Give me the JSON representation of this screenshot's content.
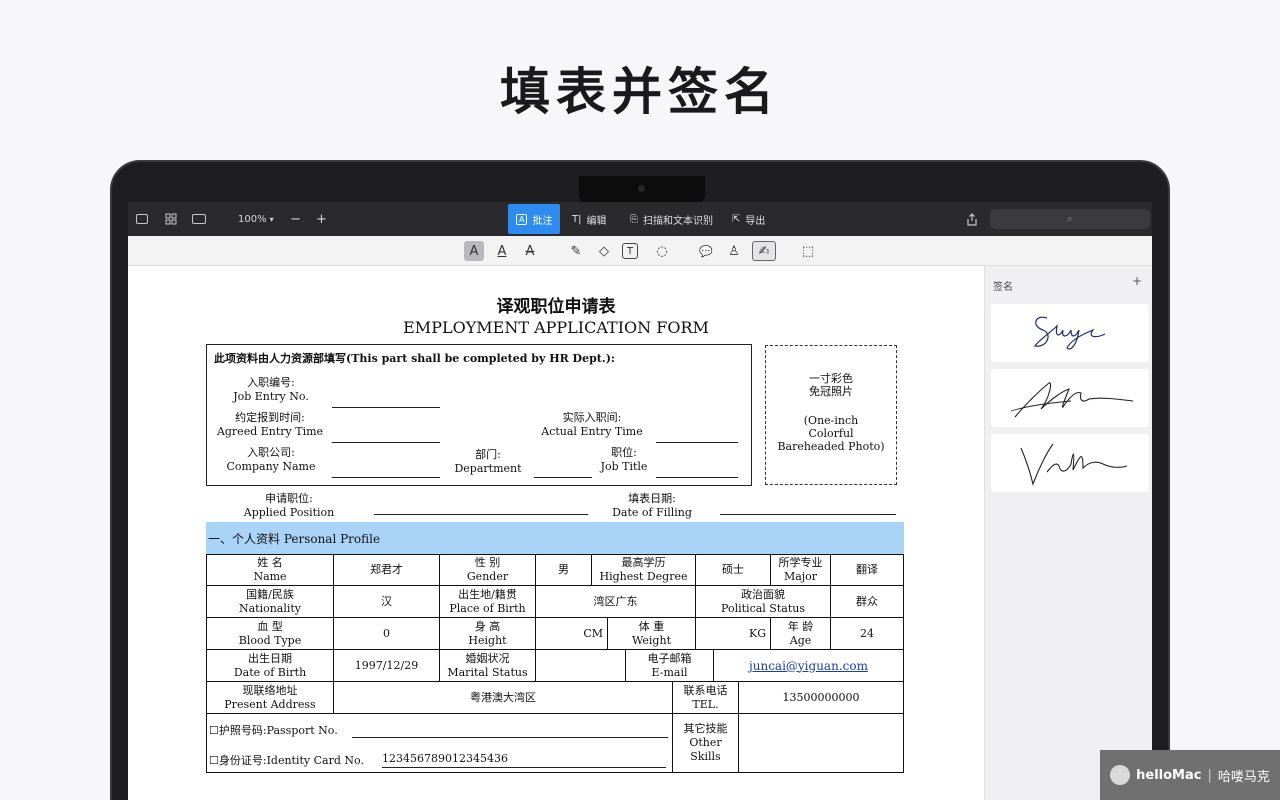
{
  "hero_title": "填表并签名",
  "toolbar": {
    "zoom": "100%",
    "zoom_minus": "−",
    "zoom_plus": "+",
    "tabs": [
      {
        "label": "批注",
        "icon": "A"
      },
      {
        "label": "编辑",
        "icon": "T|"
      },
      {
        "label": "扫描和文本识别",
        "icon": "⎘"
      },
      {
        "label": "导出",
        "icon": "⇱"
      }
    ],
    "search_icon": "⌕"
  },
  "annotation_tools": [
    "A",
    "A",
    "A",
    "✎",
    "◇",
    "T",
    "◌",
    "💬",
    "♙",
    "✍",
    "⬚"
  ],
  "sidepanel": {
    "title": "签名",
    "add": "+"
  },
  "form": {
    "title_cn": "译观职位申请表",
    "title_en": "EMPLOYMENT APPLICATION FORM",
    "hr_heading": "此项资料由人力资源部填写(This part shall be completed by HR Dept.):",
    "job_entry_cn": "入职编号:",
    "job_entry_en": "Job Entry No.",
    "agreed_entry_cn": "约定报到时间:",
    "agreed_entry_en": "Agreed Entry Time",
    "actual_entry_cn": "实际入职间:",
    "actual_entry_en": "Actual Entry Time",
    "company_cn": "入职公司:",
    "company_en": "Company Name",
    "department_cn": "部门:",
    "department_en": "Department",
    "job_title_cn": "职位:",
    "job_title_en": "Job Title",
    "photo_line1": "一寸彩色",
    "photo_line2": "免冠照片",
    "photo_line3": "(One-inch",
    "photo_line4": "Colorful",
    "photo_line5": "Bareheaded Photo)",
    "applied_cn": "申请职位:",
    "applied_en": "Applied Position",
    "filling_cn": "填表日期:",
    "filling_en": "Date of Filling",
    "section1": "一、个人资料 Personal Profile",
    "name_cn": "姓  名",
    "name_en": "Name",
    "name_val": "郑君才",
    "gender_cn": "性  别",
    "gender_en": "Gender",
    "gender_val": "男",
    "degree_cn": "最高学历",
    "degree_en": "Highest Degree",
    "degree_val": "硕士",
    "major_cn": "所学专业",
    "major_en": "Major",
    "major_val": "翻译",
    "nat_cn": "国籍/民族",
    "nat_en": "Nationality",
    "nat_val": "汉",
    "birthplace_cn": "出生地/籍贯",
    "birthplace_en": "Place of Birth",
    "birthplace_val": "湾区广东",
    "political_cn": "政治面貌",
    "political_en": "Political Status",
    "political_val": "群众",
    "blood_cn": "血  型",
    "blood_en": "Blood Type",
    "blood_val": "0",
    "height_cn": "身  高",
    "height_en": "Height",
    "height_unit": "CM",
    "weight_cn": "体  重",
    "weight_en": "Weight",
    "weight_unit": "KG",
    "age_cn": "年  龄",
    "age_en": "Age",
    "age_val": "24",
    "dob_cn": "出生日期",
    "dob_en": "Date of Birth",
    "dob_val": "1997/12/29",
    "marital_cn": "婚姻状况",
    "marital_en": "Marital Status",
    "email_cn": "电子邮箱",
    "email_en": "E-mail",
    "email_val": "juncai@yiguan.com",
    "address_cn": "现联络地址",
    "address_en": "Present Address",
    "address_val": "粤港澳大湾区",
    "tel_cn": "联系电话",
    "tel_en": "TEL.",
    "tel_val": "13500000000",
    "passport": "☐护照号码:Passport No.",
    "idcard_label": "☐身份证号:Identity Card No.",
    "idcard_val": "123456789012345436",
    "skills_cn": "其它技能",
    "skills_en1": "Other",
    "skills_en2": "Skills"
  },
  "watermark": {
    "brand": "helloMac",
    "sep": "|",
    "cn": "哈喽马克"
  }
}
